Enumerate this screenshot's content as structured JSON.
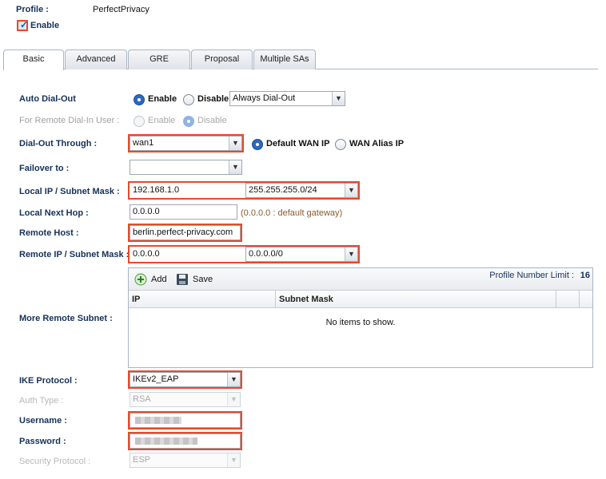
{
  "profile": {
    "label": "Profile :",
    "value": "PerfectPrivacy"
  },
  "enable": {
    "label": "Enable",
    "checked": true
  },
  "tabs": [
    {
      "label": "Basic",
      "active": true
    },
    {
      "label": "Advanced",
      "active": false
    },
    {
      "label": "GRE",
      "active": false
    },
    {
      "label": "Proposal",
      "active": false
    },
    {
      "label": "Multiple SAs",
      "active": false
    }
  ],
  "form": {
    "auto_dial_out": {
      "label": "Auto Dial-Out",
      "enable": "Enable",
      "disable": "Disable",
      "selected": "Enable",
      "mode": "Always Dial-Out"
    },
    "remote_dial_in": {
      "label": "For Remote Dial-In User :",
      "enable": "Enable",
      "disable": "Disable",
      "selected": "Disable"
    },
    "dial_out_through": {
      "label": "Dial-Out Through :",
      "value": "wan1",
      "default_wan_ip": "Default WAN IP",
      "wan_alias_ip": "WAN Alias IP",
      "selected": "Default WAN IP"
    },
    "failover_to": {
      "label": "Failover to :",
      "value": ""
    },
    "local_ip": {
      "label": "Local IP / Subnet Mask :",
      "ip": "192.168.1.0",
      "mask": "255.255.255.0/24"
    },
    "local_next_hop": {
      "label": "Local Next Hop :",
      "value": "0.0.0.0",
      "hint": "(0.0.0.0 : default gateway)"
    },
    "remote_host": {
      "label": "Remote Host :",
      "value": "berlin.perfect-privacy.com"
    },
    "remote_ip": {
      "label": "Remote IP / Subnet Mask :",
      "ip": "0.0.0.0",
      "mask": "0.0.0.0/0"
    },
    "more_remote_subnet": {
      "label": "More Remote Subnet :",
      "add": "Add",
      "save": "Save",
      "limit_label": "Profile Number Limit :",
      "limit_value": "16",
      "columns": [
        "IP",
        "Subnet Mask"
      ],
      "empty_text": "No items to show."
    },
    "ike_protocol": {
      "label": "IKE Protocol :",
      "value": "IKEv2_EAP"
    },
    "auth_type": {
      "label": "Auth Type :",
      "value": "RSA"
    },
    "username": {
      "label": "Username :",
      "value": ""
    },
    "password": {
      "label": "Password :",
      "value": ""
    },
    "security_protocol": {
      "label": "Security Protocol :",
      "value": "ESP"
    }
  },
  "colors": {
    "highlight": "#e8492c",
    "label": "#15315a",
    "radio_on": "#2c67c1"
  }
}
